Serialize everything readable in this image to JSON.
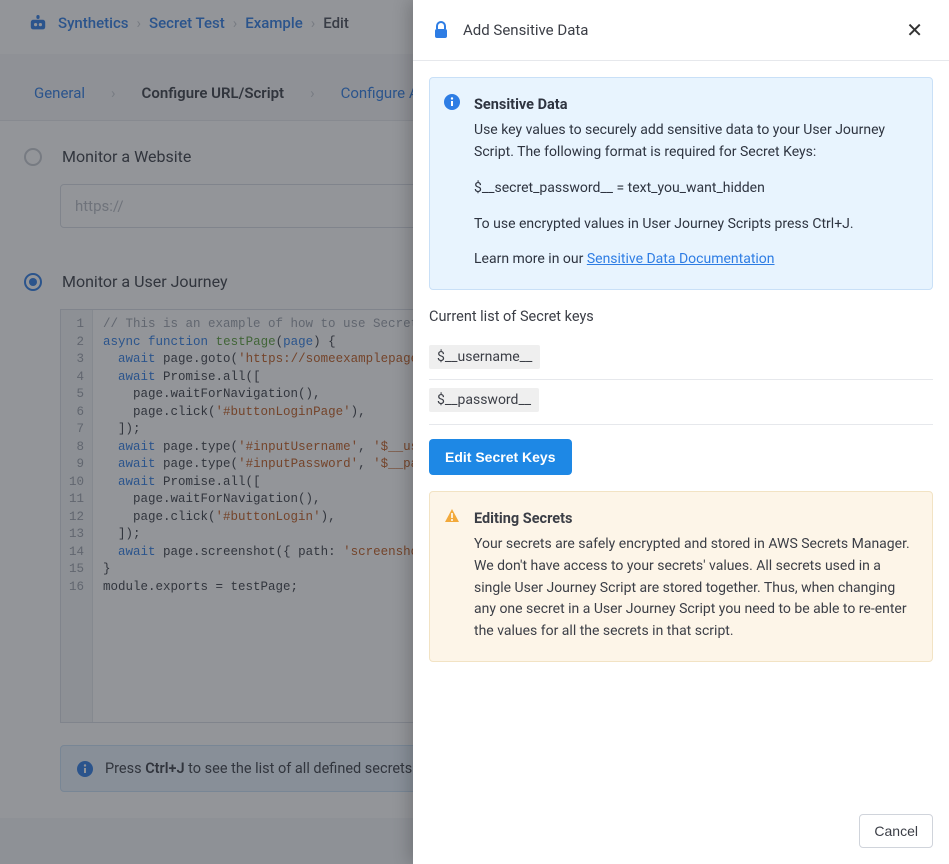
{
  "breadcrumbs": [
    "Synthetics",
    "Secret Test",
    "Example",
    "Edit"
  ],
  "steps": {
    "general": "General",
    "configure": "Configure URL/Script",
    "alerts": "Configure Alerts"
  },
  "monitor": {
    "website_label": "Monitor a Website",
    "url_placeholder": "https://",
    "journey_label": "Monitor a User Journey"
  },
  "code": {
    "lines": [
      "// This is an example of how to use Secrets in",
      "async function testPage(page) {",
      "  await page.goto('https://someexamplepage.com');",
      "  await Promise.all([",
      "    page.waitForNavigation(),",
      "    page.click('#buttonLoginPage'),",
      "  ]);",
      "  await page.type('#inputUsername', '$__username__');",
      "  await page.type('#inputPassword', '$__password__');",
      "  await Promise.all([",
      "    page.waitForNavigation(),",
      "    page.click('#buttonLogin'),",
      "  ]);",
      "  await page.screenshot({ path: 'screenshot.jpg' });",
      "}",
      "module.exports = testPage;"
    ]
  },
  "hint": {
    "prefix": "Press ",
    "shortcut": "Ctrl+J",
    "suffix": " to see the list of all defined secrets"
  },
  "panel": {
    "title": "Add Sensitive Data",
    "info": {
      "heading": "Sensitive Data",
      "body": "Use key values to securely add sensitive data to your User Journey Script. The following format is required for Secret Keys:",
      "format": "$__secret_password__ = text_you_want_hidden",
      "ctrlj": "To use encrypted values in User Journey Scripts press Ctrl+J.",
      "learn_prefix": "Learn more in our ",
      "doc_link": "Sensitive Data Documentation"
    },
    "list_label": "Current list of Secret keys",
    "keys": [
      "$__username__",
      "$__password__"
    ],
    "edit_button": "Edit Secret Keys",
    "warn": {
      "heading": "Editing Secrets",
      "body": "Your secrets are safely encrypted and stored in AWS Secrets Manager. We don't have access to your secrets' values. All secrets used in a single User Journey Script are stored together. Thus, when changing any one secret in a User Journey Script you need to be able to re-enter the values for all the secrets in that script."
    },
    "cancel": "Cancel"
  }
}
